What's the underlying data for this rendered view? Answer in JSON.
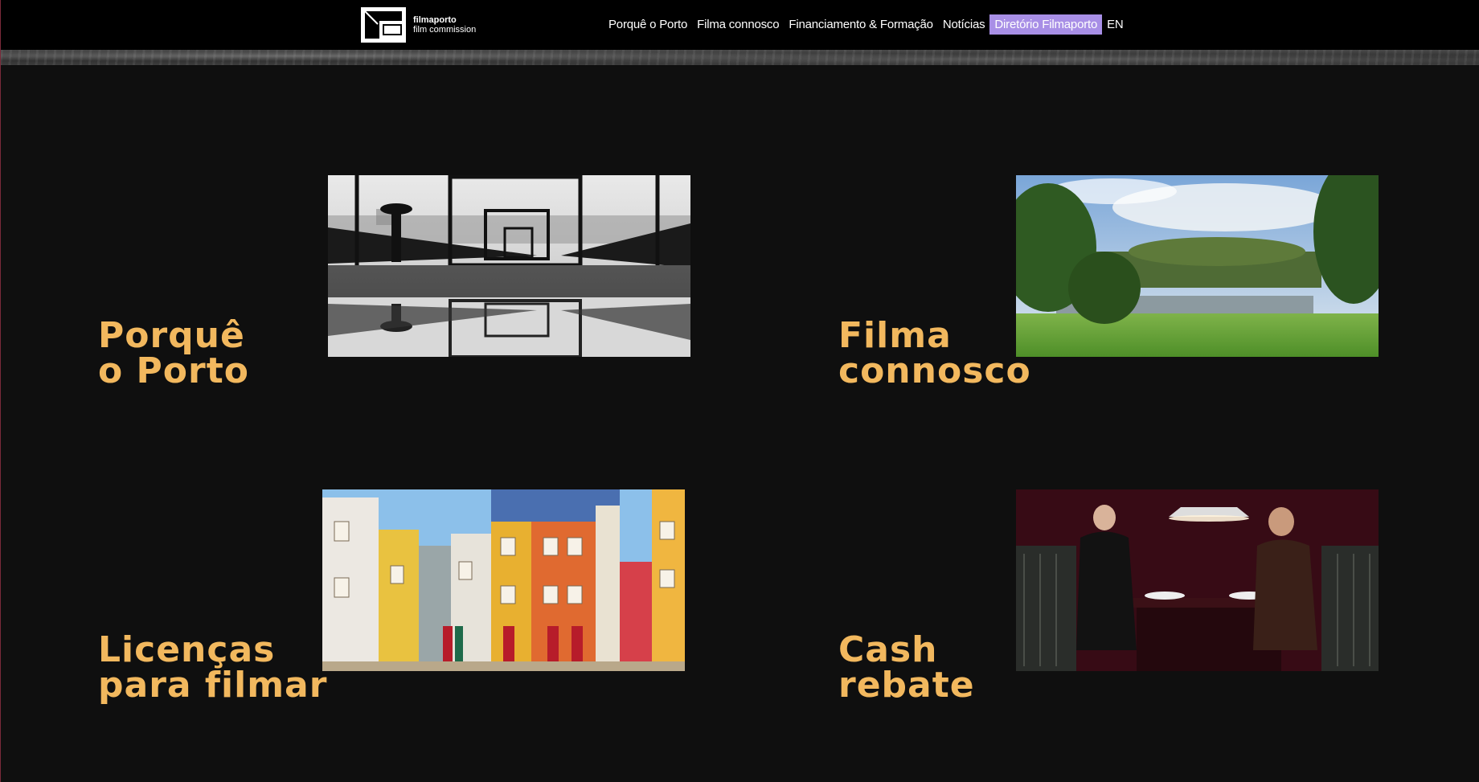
{
  "header": {
    "logo": {
      "name": "filmaporto",
      "subtitle": "film commission"
    },
    "nav": [
      {
        "label": "Porquê o Porto"
      },
      {
        "label": "Filma connosco"
      },
      {
        "label": "Financiamento & Formação"
      },
      {
        "label": "Notícias"
      },
      {
        "label": "Diretório Filmaporto",
        "highlighted": true
      },
      {
        "label": "EN"
      }
    ]
  },
  "cards": [
    {
      "title_line1": "Porquê",
      "title_line2": "o Porto",
      "image": "bridge-reflection-bw-photo"
    },
    {
      "title_line1": "Filma",
      "title_line2": "connosco",
      "image": "park-lake-photo"
    },
    {
      "title_line1": "Licenças",
      "title_line2": "para filmar",
      "image": "colorful-houses-photo"
    },
    {
      "title_line1": "Cash",
      "title_line2": "rebate",
      "image": "diner-couple-photo"
    }
  ],
  "colors": {
    "background": "#0f0f0f",
    "header": "#000000",
    "title": "#f2b85e",
    "nav_highlight": "#a88fe6"
  }
}
